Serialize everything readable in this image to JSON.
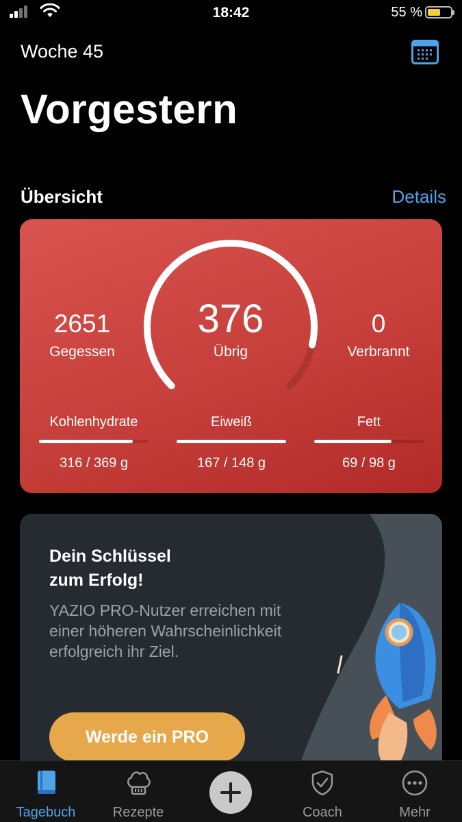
{
  "status_bar": {
    "time": "18:42",
    "battery_percent": "55 %",
    "battery_level": 0.55
  },
  "header": {
    "week": "Woche 45",
    "title": "Vorgestern",
    "calendar_icon": "calendar-icon"
  },
  "overview": {
    "section_title": "Übersicht",
    "details_link": "Details",
    "eaten_value": "2651",
    "eaten_label": "Gegessen",
    "remaining_value": "376",
    "remaining_label": "Übrig",
    "burned_value": "0",
    "burned_label": "Verbrannt",
    "gauge_progress": 0.88,
    "colors": {
      "card": "#c63f3a"
    },
    "macros": [
      {
        "name": "Kohlenhydrate",
        "value": "316 / 369 g",
        "progress": 0.856
      },
      {
        "name": "Eiweiß",
        "value": "167 / 148 g",
        "progress": 1.0
      },
      {
        "name": "Fett",
        "value": "69 / 98 g",
        "progress": 0.704
      }
    ]
  },
  "promo": {
    "title_line1": "Dein Schlüssel",
    "title_line2": "zum Erfolg!",
    "text": "YAZIO PRO-Nutzer erreichen mit einer höheren Wahrscheinlichkeit erfolgreich ihr Ziel.",
    "button_label": "Werde ein PRO",
    "colors": {
      "button": "#e6a84a",
      "card": "#252b31"
    }
  },
  "tab_bar": {
    "items": [
      {
        "label": "Tagebuch",
        "icon": "book-icon",
        "active": true
      },
      {
        "label": "Rezepte",
        "icon": "chef-hat-icon",
        "active": false
      },
      {
        "label": "",
        "icon": "plus-icon",
        "active": false
      },
      {
        "label": "Coach",
        "icon": "shield-check-icon",
        "active": false
      },
      {
        "label": "Mehr",
        "icon": "more-icon",
        "active": false
      }
    ],
    "active_color": "#4ea4e6"
  }
}
